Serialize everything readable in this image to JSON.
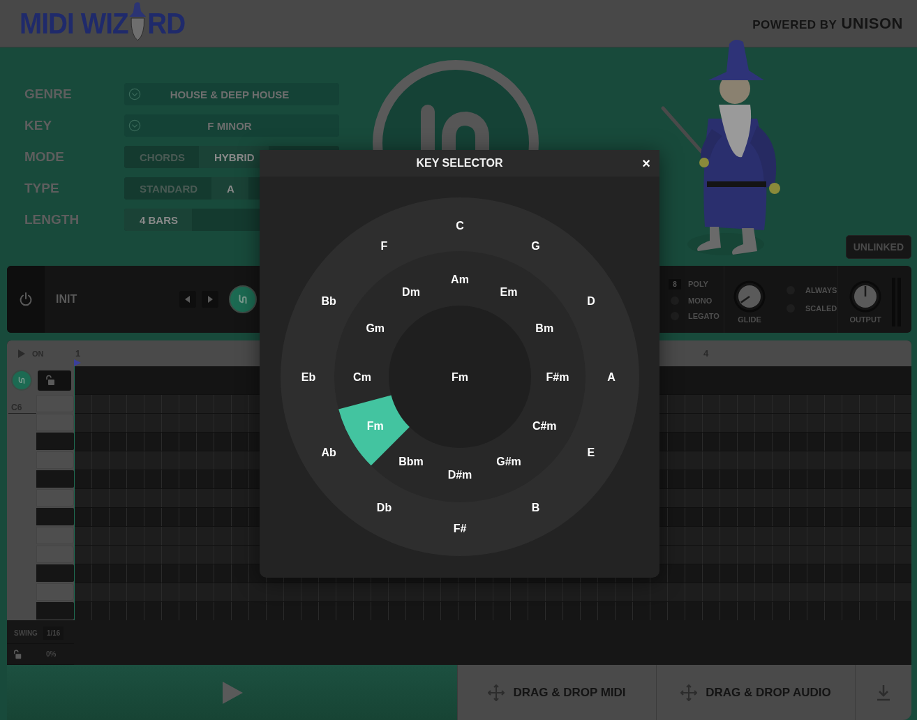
{
  "header": {
    "logo": [
      "MIDI WIZ",
      "RD"
    ],
    "powered_by": "POWERED BY",
    "brand": "UNISON"
  },
  "form": [
    {
      "label": "GENRE",
      "kind": "dropdown",
      "value": "HOUSE & DEEP HOUSE"
    },
    {
      "label": "KEY",
      "kind": "dropdown",
      "value": "F MINOR"
    },
    {
      "label": "MODE",
      "kind": "segmented",
      "options": [
        {
          "label": "CHORDS",
          "selected": false
        },
        {
          "label": "HYBRID",
          "selected": true
        }
      ]
    },
    {
      "label": "TYPE",
      "kind": "segmented",
      "options": [
        {
          "label": "STANDARD",
          "selected": false
        },
        {
          "label": "A",
          "selected": true
        }
      ]
    },
    {
      "label": "LENGTH",
      "kind": "segmented",
      "options": [
        {
          "label": "4 BARS",
          "selected": true
        }
      ]
    }
  ],
  "link_button": "UNLINKED",
  "instrument": {
    "preset": "INIT",
    "voices": "8",
    "voice_modes": [
      {
        "label": "POLY",
        "selected": true
      },
      {
        "label": "MONO",
        "selected": false
      },
      {
        "label": "LEGATO",
        "selected": false
      }
    ],
    "glide": {
      "label": "GLIDE"
    },
    "glide_modes": [
      {
        "label": "ALWAYS",
        "selected": false
      },
      {
        "label": "SCALED",
        "selected": false
      }
    ],
    "output": {
      "label": "OUTPUT"
    }
  },
  "piano_roll": {
    "play_label": "ON",
    "bar_numbers": [
      "1",
      "4"
    ],
    "top_note": "C6",
    "swing": {
      "label": "SWING",
      "division": "1/16",
      "amount": "0%"
    }
  },
  "actions": [
    {
      "kind": "midi",
      "label": "DRAG & DROP MIDI"
    },
    {
      "kind": "audio",
      "label": "DRAG & DROP AUDIO"
    },
    {
      "kind": "download"
    }
  ],
  "key_selector": {
    "title": "KEY SELECTOR",
    "close": "×",
    "center": "Fm",
    "major": [
      {
        "label": "C"
      },
      {
        "label": "G"
      },
      {
        "label": "D"
      },
      {
        "label": "A"
      },
      {
        "label": "E"
      },
      {
        "label": "B"
      },
      {
        "label": "F#"
      },
      {
        "label": "Db"
      },
      {
        "label": "Ab"
      },
      {
        "label": "Eb"
      },
      {
        "label": "Bb"
      },
      {
        "label": "F"
      }
    ],
    "minor": [
      {
        "label": "Am",
        "selected": false
      },
      {
        "label": "Em",
        "selected": false
      },
      {
        "label": "Bm",
        "selected": false
      },
      {
        "label": "F#m",
        "selected": false
      },
      {
        "label": "C#m",
        "selected": false
      },
      {
        "label": "G#m",
        "selected": false
      },
      {
        "label": "D#m",
        "selected": false
      },
      {
        "label": "Bbm",
        "selected": false
      },
      {
        "label": "Fm",
        "selected": true
      },
      {
        "label": "Cm",
        "selected": false
      },
      {
        "label": "Gm",
        "selected": false
      },
      {
        "label": "Dm",
        "selected": false
      }
    ]
  }
}
